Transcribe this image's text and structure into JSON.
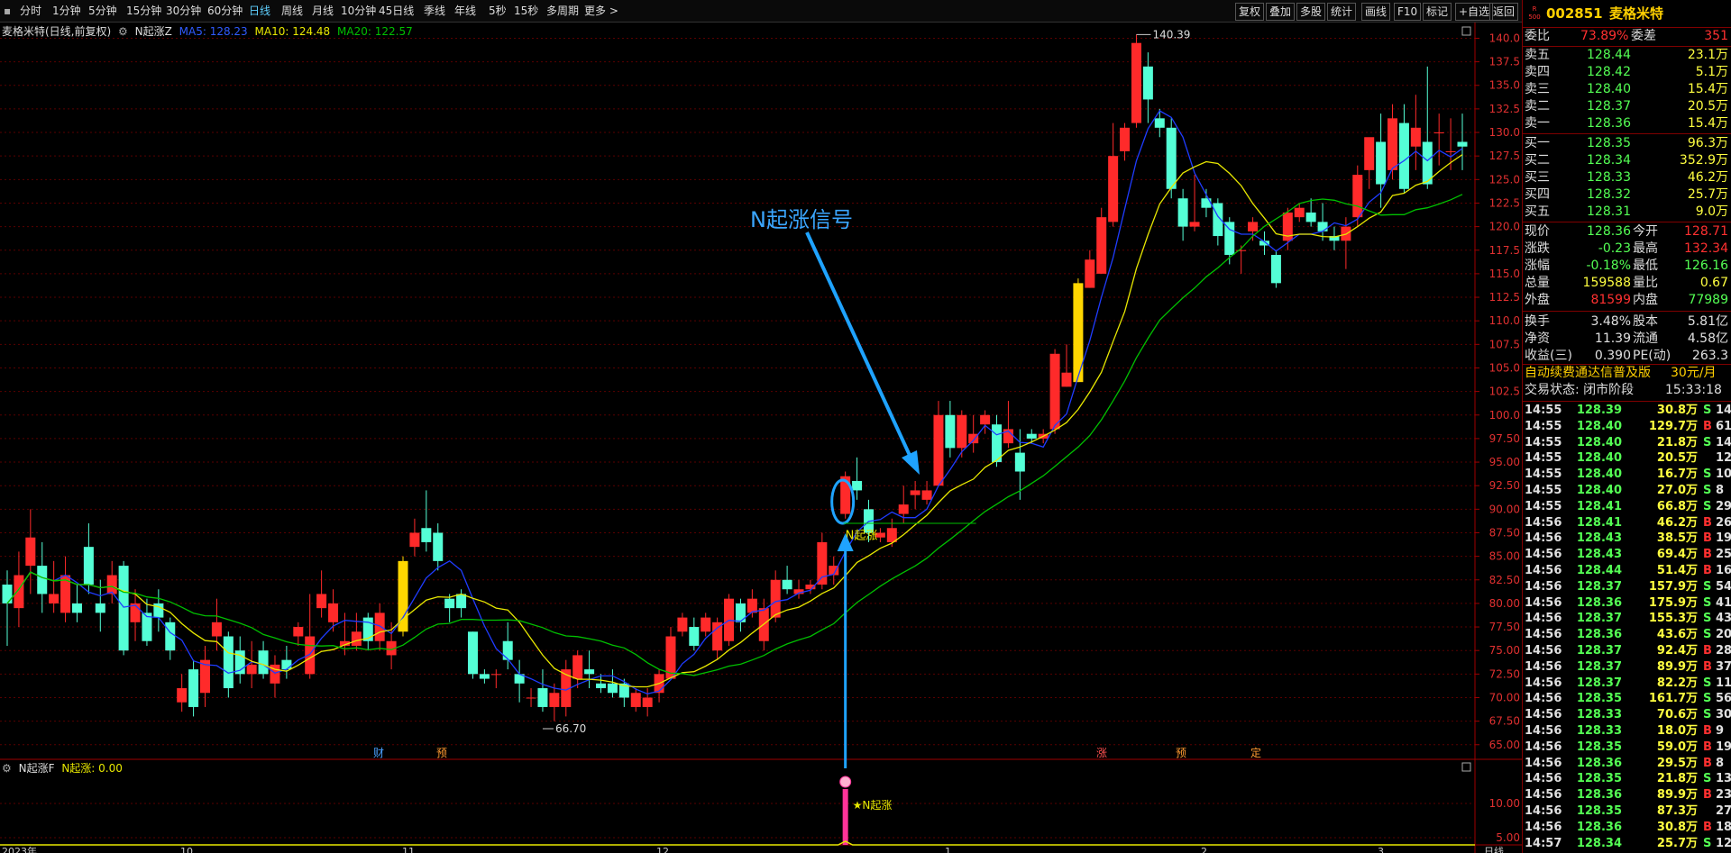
{
  "toolbar": {
    "periods": [
      "分时",
      "1分钟",
      "5分钟",
      "15分钟",
      "30分钟",
      "60分钟",
      "日线",
      "周线",
      "月线",
      "10分钟",
      "45日线",
      "季线",
      "年线",
      "5秒",
      "15秒",
      "多周期",
      "更多 >"
    ],
    "active_period": "日线",
    "right_buttons": [
      "复权",
      "叠加",
      "多股",
      "统计",
      "画线",
      "F10",
      "标记",
      "+自选",
      "返回"
    ]
  },
  "main_info": {
    "stock": "麦格米特(日线,前复权)",
    "indicator": "N起涨Z",
    "ma5": "MA5: 128.23",
    "ma10": "MA10: 124.48",
    "ma20": "MA20: 122.57"
  },
  "sub_info": {
    "indicator": "N起涨F",
    "value": "N起涨: 0.00"
  },
  "annotation": {
    "text": "N起涨信号"
  },
  "price_axis": [
    "140.0",
    "137.5",
    "135.0",
    "132.5",
    "130.0",
    "127.5",
    "125.0",
    "122.5",
    "120.0",
    "117.5",
    "115.0",
    "112.5",
    "110.0",
    "107.5",
    "105.0",
    "102.5",
    "100.0",
    "97.50",
    "95.00",
    "92.50",
    "90.00",
    "87.50",
    "85.00",
    "82.50",
    "80.00",
    "77.50",
    "75.00",
    "72.50",
    "70.00",
    "67.50",
    "65.00"
  ],
  "sub_axis": [
    "10.00",
    "5.00"
  ],
  "chart_labels": {
    "high": "140.39",
    "low": "66.70",
    "signal_main": "N起涨",
    "signal_sub": "★N起涨",
    "events": [
      "财",
      "预",
      "涨",
      "预",
      "定"
    ],
    "date_axis": [
      "2023年",
      "10",
      "11",
      "12",
      "1",
      "2",
      "3"
    ],
    "date_unit": "日线"
  },
  "colors": {
    "up": "#ff2a2a",
    "down": "#54ffd6",
    "ma5": "#1f3cff",
    "ma10": "#e8e800",
    "ma20": "#00c000",
    "arrow": "#1fa3ff",
    "signal": "#ff3399"
  },
  "quote": {
    "market_icon": "R\n500",
    "code": "002851",
    "name": "麦格米特",
    "webi_label": "委比",
    "webi": "73.89%",
    "weicha_label": "委差",
    "weicha": "351",
    "asks": [
      {
        "label": "卖五",
        "price": "128.44",
        "vol": "23.1万"
      },
      {
        "label": "卖四",
        "price": "128.42",
        "vol": "5.1万"
      },
      {
        "label": "卖三",
        "price": "128.40",
        "vol": "15.4万"
      },
      {
        "label": "卖二",
        "price": "128.37",
        "vol": "20.5万"
      },
      {
        "label": "卖一",
        "price": "128.36",
        "vol": "15.4万"
      }
    ],
    "bids": [
      {
        "label": "买一",
        "price": "128.35",
        "vol": "96.3万"
      },
      {
        "label": "买二",
        "price": "128.34",
        "vol": "352.9万"
      },
      {
        "label": "买三",
        "price": "128.33",
        "vol": "46.2万"
      },
      {
        "label": "买四",
        "price": "128.32",
        "vol": "25.7万"
      },
      {
        "label": "买五",
        "price": "128.31",
        "vol": "9.0万"
      }
    ],
    "stats": [
      {
        "l1": "现价",
        "v1": "128.36",
        "c1": "#54ff54",
        "l2": "今开",
        "v2": "128.71",
        "c2": "#ff3030"
      },
      {
        "l1": "涨跌",
        "v1": "-0.23",
        "c1": "#54ff54",
        "l2": "最高",
        "v2": "132.34",
        "c2": "#ff3030"
      },
      {
        "l1": "涨幅",
        "v1": "-0.18%",
        "c1": "#54ff54",
        "l2": "最低",
        "v2": "126.16",
        "c2": "#54ff54"
      },
      {
        "l1": "总量",
        "v1": "159588",
        "c1": "#ffff40",
        "l2": "量比",
        "v2": "0.67",
        "c2": "#ffff40"
      },
      {
        "l1": "外盘",
        "v1": "81599",
        "c1": "#ff3030",
        "l2": "内盘",
        "v2": "77989",
        "c2": "#54ff54"
      },
      {
        "l1": "换手",
        "v1": "3.48%",
        "c1": "#e0e0e0",
        "l2": "股本",
        "v2": "5.81亿",
        "c2": "#e0e0e0"
      },
      {
        "l1": "净资",
        "v1": "11.39",
        "c1": "#e0e0e0",
        "l2": "流通",
        "v2": "4.58亿",
        "c2": "#e0e0e0"
      },
      {
        "l1": "收益(三)",
        "v1": "0.390",
        "c1": "#e0e0e0",
        "l2": "PE(动)",
        "v2": "263.3",
        "c2": "#e0e0e0"
      }
    ],
    "promo": "自动续费通达信普及版",
    "promo_price": "30元/月",
    "status_label": "交易状态: 闭市阶段",
    "status_time": "15:33:18"
  },
  "trades": [
    {
      "t": "14:55",
      "p": "128.39",
      "v": "30.8万",
      "s": "S",
      "n": "14"
    },
    {
      "t": "14:55",
      "p": "128.40",
      "v": "129.7万",
      "s": "B",
      "n": "61"
    },
    {
      "t": "14:55",
      "p": "128.40",
      "v": "21.8万",
      "s": "S",
      "n": "14"
    },
    {
      "t": "14:55",
      "p": "128.40",
      "v": "20.5万",
      "s": "",
      "n": "12"
    },
    {
      "t": "14:55",
      "p": "128.40",
      "v": "16.7万",
      "s": "S",
      "n": "10"
    },
    {
      "t": "14:55",
      "p": "128.40",
      "v": "27.0万",
      "s": "S",
      "n": "8"
    },
    {
      "t": "14:55",
      "p": "128.41",
      "v": "66.8万",
      "s": "S",
      "n": "29"
    },
    {
      "t": "14:56",
      "p": "128.41",
      "v": "46.2万",
      "s": "B",
      "n": "26"
    },
    {
      "t": "14:56",
      "p": "128.43",
      "v": "38.5万",
      "s": "B",
      "n": "19"
    },
    {
      "t": "14:56",
      "p": "128.43",
      "v": "69.4万",
      "s": "B",
      "n": "25"
    },
    {
      "t": "14:56",
      "p": "128.44",
      "v": "51.4万",
      "s": "B",
      "n": "16"
    },
    {
      "t": "14:56",
      "p": "128.37",
      "v": "157.9万",
      "s": "S",
      "n": "54"
    },
    {
      "t": "14:56",
      "p": "128.36",
      "v": "175.9万",
      "s": "S",
      "n": "41"
    },
    {
      "t": "14:56",
      "p": "128.37",
      "v": "155.3万",
      "s": "S",
      "n": "43"
    },
    {
      "t": "14:56",
      "p": "128.36",
      "v": "43.6万",
      "s": "S",
      "n": "20"
    },
    {
      "t": "14:56",
      "p": "128.37",
      "v": "92.4万",
      "s": "B",
      "n": "28"
    },
    {
      "t": "14:56",
      "p": "128.37",
      "v": "89.9万",
      "s": "B",
      "n": "37"
    },
    {
      "t": "14:56",
      "p": "128.37",
      "v": "82.2万",
      "s": "S",
      "n": "11"
    },
    {
      "t": "14:56",
      "p": "128.35",
      "v": "161.7万",
      "s": "S",
      "n": "56"
    },
    {
      "t": "14:56",
      "p": "128.33",
      "v": "70.6万",
      "s": "S",
      "n": "30"
    },
    {
      "t": "14:56",
      "p": "128.33",
      "v": "18.0万",
      "s": "B",
      "n": "9"
    },
    {
      "t": "14:56",
      "p": "128.35",
      "v": "59.0万",
      "s": "B",
      "n": "19"
    },
    {
      "t": "14:56",
      "p": "128.36",
      "v": "29.5万",
      "s": "B",
      "n": "8"
    },
    {
      "t": "14:56",
      "p": "128.35",
      "v": "21.8万",
      "s": "S",
      "n": "13"
    },
    {
      "t": "14:56",
      "p": "128.36",
      "v": "89.9万",
      "s": "B",
      "n": "23"
    },
    {
      "t": "14:56",
      "p": "128.35",
      "v": "87.3万",
      "s": "",
      "n": "27"
    },
    {
      "t": "14:56",
      "p": "128.36",
      "v": "30.8万",
      "s": "B",
      "n": "18"
    },
    {
      "t": "14:57",
      "p": "128.34",
      "v": "25.7万",
      "s": "S",
      "n": "12"
    }
  ],
  "chart_data": {
    "type": "candlestick",
    "candles": [
      [
        82.0,
        80.0,
        83.5,
        75.5
      ],
      [
        79.5,
        83.0,
        85.5,
        77.5
      ],
      [
        84.0,
        87.0,
        90.0,
        81.0
      ],
      [
        84.0,
        81.0,
        86.5,
        79.0
      ],
      [
        80.0,
        81.0,
        84.5,
        79.0
      ],
      [
        79.0,
        83.0,
        85.0,
        78.0
      ],
      [
        80.0,
        79.0,
        82.0,
        78.0
      ],
      [
        86.0,
        82.0,
        88.5,
        81.0
      ],
      [
        80.0,
        79.0,
        82.5,
        77.0
      ],
      [
        81.0,
        83.0,
        84.5,
        80.0
      ],
      [
        84.0,
        75.0,
        84.5,
        74.5
      ],
      [
        78.0,
        80.0,
        81.5,
        76.0
      ],
      [
        79.0,
        76.0,
        80.5,
        75.5
      ],
      [
        80.0,
        78.5,
        81.5,
        77.0
      ],
      [
        78.0,
        75.0,
        78.5,
        74.0
      ],
      [
        69.5,
        71.0,
        72.5,
        68.5
      ],
      [
        73.0,
        69.0,
        74.0,
        68.0
      ],
      [
        70.5,
        74.0,
        75.5,
        69.0
      ],
      [
        76.5,
        78.0,
        80.5,
        75.0
      ],
      [
        76.5,
        71.0,
        77.0,
        70.0
      ],
      [
        75.0,
        72.5,
        76.5,
        71.5
      ],
      [
        72.5,
        73.5,
        76.0,
        71.0
      ],
      [
        75.0,
        72.5,
        76.0,
        72.0
      ],
      [
        71.5,
        73.5,
        74.5,
        70.0
      ],
      [
        74.0,
        73.0,
        75.5,
        72.0
      ],
      [
        76.5,
        77.5,
        78.0,
        75.5
      ],
      [
        72.5,
        76.5,
        81.0,
        72.0
      ],
      [
        79.5,
        81.0,
        83.5,
        78.5
      ],
      [
        78.0,
        80.0,
        81.5,
        77.0
      ],
      [
        75.5,
        76.0,
        79.0,
        74.5
      ],
      [
        75.5,
        77.0,
        79.0,
        75.0
      ],
      [
        78.5,
        76.0,
        79.0,
        75.0
      ],
      [
        76.0,
        79.0,
        80.0,
        75.0
      ],
      [
        74.5,
        76.0,
        78.0,
        73.0
      ],
      [
        77.0,
        84.5,
        85.0,
        76.5
      ],
      [
        86.0,
        87.5,
        89.0,
        85.0
      ],
      [
        88.0,
        86.5,
        92.0,
        85.5
      ],
      [
        87.5,
        84.5,
        88.5,
        83.5
      ],
      [
        80.5,
        79.5,
        81.0,
        78.0
      ],
      [
        81.0,
        79.5,
        81.5,
        78.5
      ],
      [
        77.0,
        72.5,
        77.0,
        72.0
      ],
      [
        72.5,
        72.0,
        73.0,
        71.5
      ],
      [
        72.5,
        72.5,
        73.0,
        71.0
      ],
      [
        76.0,
        74.0,
        78.0,
        73.0
      ],
      [
        72.5,
        71.5,
        74.0,
        69.5
      ],
      [
        70.0,
        70.0,
        71.0,
        69.0
      ],
      [
        71.0,
        69.0,
        73.0,
        68.5
      ],
      [
        69.0,
        70.5,
        71.5,
        67.5
      ],
      [
        69.0,
        73.0,
        74.0,
        68.0
      ],
      [
        72.0,
        74.5,
        75.0,
        71.0
      ],
      [
        73.0,
        72.5,
        75.0,
        71.0
      ],
      [
        71.5,
        71.0,
        72.5,
        70.5
      ],
      [
        71.5,
        70.5,
        73.0,
        70.0
      ],
      [
        71.5,
        70.0,
        72.0,
        69.0
      ],
      [
        69.0,
        70.5,
        71.0,
        68.5
      ],
      [
        69.0,
        70.0,
        71.0,
        68.0
      ],
      [
        70.5,
        72.5,
        73.0,
        69.5
      ],
      [
        72.0,
        76.5,
        77.5,
        72.0
      ],
      [
        77.0,
        78.5,
        79.0,
        76.5
      ],
      [
        77.5,
        75.5,
        78.5,
        75.0
      ],
      [
        77.0,
        78.5,
        79.0,
        76.5
      ],
      [
        75.0,
        78.0,
        78.5,
        74.0
      ],
      [
        76.0,
        80.5,
        81.0,
        75.5
      ],
      [
        80.0,
        78.0,
        80.5,
        77.0
      ],
      [
        79.0,
        80.5,
        81.5,
        78.5
      ],
      [
        76.0,
        79.5,
        80.5,
        75.0
      ],
      [
        78.5,
        82.5,
        83.5,
        78.0
      ],
      [
        82.5,
        81.5,
        84.0,
        81.0
      ],
      [
        81.0,
        81.5,
        82.5,
        80.5
      ],
      [
        81.5,
        82.0,
        82.5,
        81.0
      ],
      [
        82.0,
        86.5,
        87.5,
        81.5
      ],
      [
        83.0,
        84.0,
        85.0,
        82.0
      ],
      [
        89.5,
        93.5,
        94.0,
        89.0
      ],
      [
        93.0,
        92.0,
        95.5,
        91.0
      ],
      [
        90.0,
        87.5,
        91.0,
        86.5
      ],
      [
        87.0,
        87.5,
        88.0,
        86.5
      ],
      [
        86.5,
        88.0,
        89.0,
        86.0
      ],
      [
        89.5,
        90.5,
        92.5,
        88.5
      ],
      [
        91.5,
        92.0,
        93.0,
        90.0
      ],
      [
        91.0,
        92.0,
        93.0,
        90.5
      ],
      [
        92.5,
        100.0,
        101.5,
        92.5
      ],
      [
        100.0,
        96.5,
        101.5,
        95.5
      ],
      [
        96.5,
        100.0,
        100.5,
        95.5
      ],
      [
        97.0,
        98.0,
        100.0,
        96.0
      ],
      [
        99.0,
        100.0,
        100.5,
        98.0
      ],
      [
        99.0,
        95.0,
        100.0,
        94.5
      ],
      [
        97.0,
        98.5,
        101.5,
        96.5
      ],
      [
        96.0,
        94.0,
        98.5,
        91.0
      ],
      [
        98.0,
        97.5,
        98.5,
        97.0
      ],
      [
        97.5,
        98.0,
        98.5,
        97.0
      ],
      [
        98.5,
        106.5,
        107.0,
        98.0
      ],
      [
        103.0,
        104.5,
        107.5,
        103.0
      ],
      [
        103.5,
        114.0,
        114.5,
        103.5
      ],
      [
        113.5,
        116.5,
        117.5,
        113.5
      ],
      [
        115.0,
        121.0,
        122.0,
        115.0
      ],
      [
        120.5,
        127.5,
        131.0,
        120.0
      ],
      [
        128.0,
        130.5,
        131.0,
        127.0
      ],
      [
        131.0,
        139.5,
        140.39,
        130.5
      ],
      [
        137.0,
        133.5,
        138.5,
        131.0
      ],
      [
        131.5,
        130.5,
        132.5,
        129.5
      ],
      [
        130.5,
        124.0,
        131.5,
        123.0
      ],
      [
        123.0,
        120.0,
        124.0,
        118.5
      ],
      [
        120.0,
        120.5,
        125.5,
        119.5
      ],
      [
        123.0,
        122.0,
        124.0,
        121.0
      ],
      [
        122.5,
        119.0,
        123.0,
        118.0
      ],
      [
        120.5,
        117.0,
        121.0,
        116.0
      ],
      [
        117.5,
        117.5,
        118.0,
        115.0
      ],
      [
        119.5,
        120.5,
        121.0,
        118.5
      ],
      [
        118.5,
        118.0,
        119.5,
        117.0
      ],
      [
        117.0,
        114.0,
        117.5,
        113.5
      ],
      [
        118.5,
        121.5,
        122.0,
        117.5
      ],
      [
        121.0,
        122.0,
        122.5,
        120.5
      ],
      [
        121.5,
        120.5,
        123.0,
        120.0
      ],
      [
        120.5,
        119.5,
        122.5,
        118.5
      ],
      [
        119.0,
        118.5,
        120.0,
        117.5
      ],
      [
        118.5,
        120.0,
        121.0,
        115.5
      ],
      [
        121.0,
        125.5,
        126.5,
        120.0
      ],
      [
        126.0,
        129.5,
        129.0,
        124.0
      ],
      [
        129.0,
        124.5,
        132.0,
        122.0
      ],
      [
        126.0,
        131.5,
        133.0,
        125.0
      ],
      [
        131.0,
        124.0,
        133.0,
        123.5
      ],
      [
        128.5,
        130.5,
        134.0,
        126.0
      ],
      [
        129.0,
        124.5,
        137.0,
        124.0
      ],
      [
        130.0,
        130.0,
        132.0,
        126.5
      ],
      [
        128.0,
        128.0,
        131.5,
        126.0
      ],
      [
        129.0,
        128.5,
        132.0,
        126.0
      ]
    ],
    "signal_candle": 72,
    "low_marker": 46,
    "high_marker": 97,
    "yellow_candles": [
      34,
      92
    ],
    "ylim": [
      64.5,
      141.0
    ]
  }
}
